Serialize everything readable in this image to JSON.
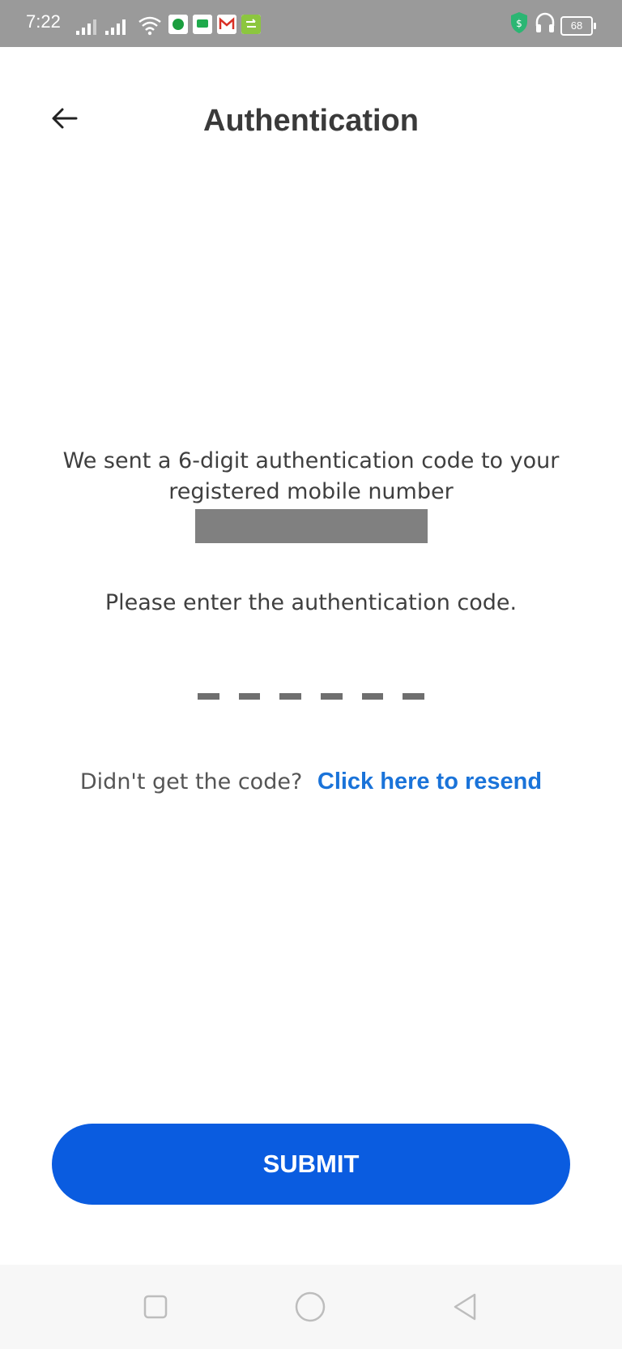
{
  "status_bar": {
    "time": "7:22",
    "battery": "68",
    "icons": [
      "signal-icon",
      "signal-icon",
      "wifi-icon",
      "evernote-icon",
      "messages-icon",
      "gmail-icon",
      "chat-icon",
      "security-shield-icon",
      "headset-icon",
      "battery-icon"
    ]
  },
  "header": {
    "title": "Authentication",
    "back_icon": "arrow-left-icon"
  },
  "message": {
    "line1": "We sent a 6-digit authentication code to your",
    "line2": "registered mobile number"
  },
  "prompt": "Please enter the authentication code.",
  "code_input": {
    "length": 6,
    "value": ""
  },
  "resend": {
    "text": "Didn't get the code?",
    "link": "Click here to resend"
  },
  "submit_label": "SUBMIT",
  "nav_bar": {
    "icons": [
      "recent-apps-icon",
      "home-icon",
      "back-icon"
    ]
  },
  "colors": {
    "accent": "#0a5ce0",
    "link": "#1a73d9",
    "status_bar": "#9a9a9a"
  }
}
